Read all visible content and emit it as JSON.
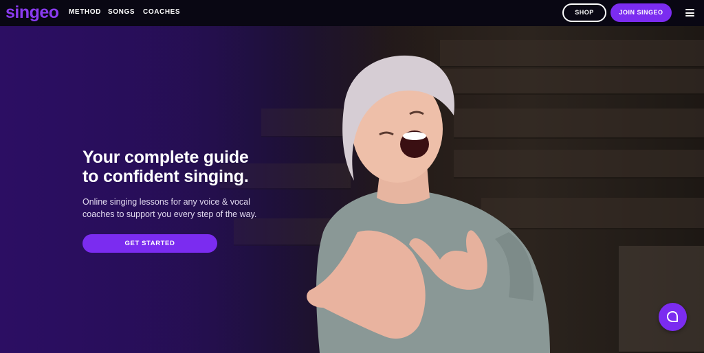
{
  "nav": {
    "logo_text": "singeo",
    "links": [
      {
        "label": "METHOD"
      },
      {
        "label": "SONGS"
      },
      {
        "label": "COACHES"
      }
    ],
    "shop_label": "SHOP",
    "join_label": "JOIN SINGEO",
    "menu_icon": "hamburger-menu-icon"
  },
  "hero": {
    "title_line1": "Your complete guide",
    "title_line2": "to confident singing.",
    "subtitle_line1": "Online singing lessons for any voice & vocal",
    "subtitle_line2": "coaches to support you every step of the way.",
    "cta_label": "GET STARTED"
  },
  "chat": {
    "icon": "chat-bubble-icon"
  },
  "colors": {
    "accent": "#7b2cf0",
    "nav_bg": "#090713",
    "logo": "#8a3bf0"
  }
}
